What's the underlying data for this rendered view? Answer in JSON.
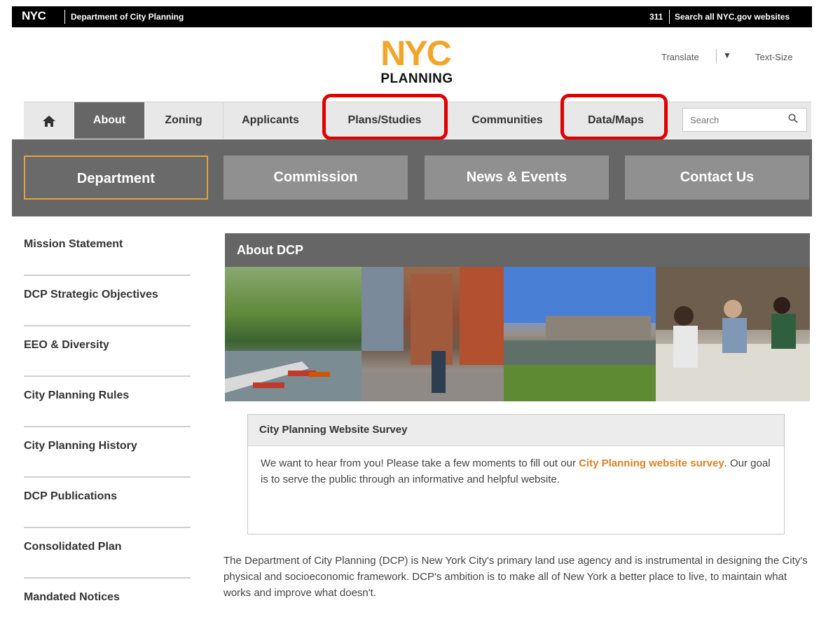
{
  "topbar": {
    "brand": "NYC",
    "department": "Department of City Planning",
    "link_311": "311",
    "search_all": "Search all NYC.gov websites"
  },
  "logo": {
    "nyc": "NYC",
    "planning": "PLANNING"
  },
  "utility": {
    "translate": "Translate",
    "translate_arrow": "▼",
    "text_size": "Text-Size"
  },
  "main_nav": {
    "home_icon": "home-icon",
    "items": [
      {
        "label": "About",
        "active": true
      },
      {
        "label": "Zoning"
      },
      {
        "label": "Applicants"
      },
      {
        "label": "Plans/Studies",
        "highlighted": true
      },
      {
        "label": "Communities"
      },
      {
        "label": "Data/Maps",
        "highlighted": true
      }
    ],
    "search_placeholder": "Search",
    "search_icon": "magnifier-icon"
  },
  "sub_nav": {
    "items": [
      {
        "label": "Department",
        "active": true
      },
      {
        "label": "Commission"
      },
      {
        "label": "News & Events"
      },
      {
        "label": "Contact Us"
      }
    ]
  },
  "sidebar": {
    "items": [
      "Mission Statement",
      "DCP Strategic Objectives",
      "EEO & Diversity",
      "City Planning Rules",
      "City Planning History",
      "DCP Publications",
      "Consolidated Plan",
      "Mandated Notices"
    ]
  },
  "content": {
    "section_title": "About DCP",
    "survey": {
      "title": "City Planning Website Survey",
      "text_before": "We want to hear from you! Please take a few moments to fill out our ",
      "link": "City Planning website survey",
      "text_after": ". Our goal is to serve the public through an informative and helpful website."
    },
    "intro": "The Department of City Planning (DCP) is New York City's primary land use agency and is instrumental in designing the City's physical and socioeconomic framework. DCP's ambition is to make all of New York a better place to live, to maintain what works and improve what doesn't."
  },
  "colors": {
    "accent": "#f3a52b",
    "link": "#d98326",
    "highlight": "#e00000",
    "nav_dark": "#666666"
  }
}
